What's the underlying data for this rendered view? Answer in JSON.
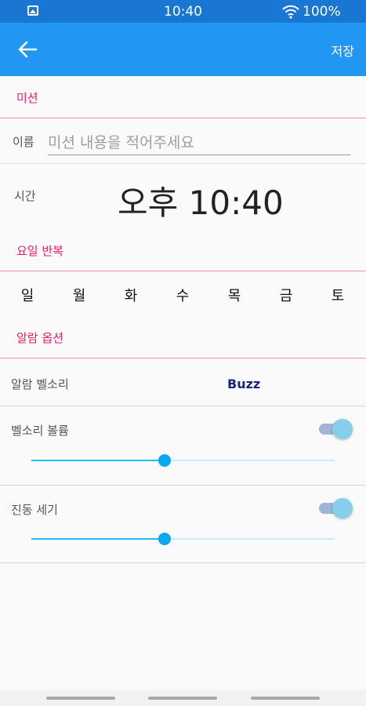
{
  "status_bar": {
    "time": "10:40",
    "battery": "100%",
    "icons": [
      "gallery-icon",
      "wifi-icon"
    ]
  },
  "app_bar": {
    "back_icon": "arrow-left-icon",
    "save_label": "저장"
  },
  "mission": {
    "header": "미션",
    "name_label": "이름",
    "name_value": "",
    "name_placeholder": "미션 내용을 적어주세요",
    "time_label": "시간",
    "time_value": "오후 10:40"
  },
  "repeat": {
    "header": "요일 반복",
    "days": [
      "일",
      "월",
      "화",
      "수",
      "목",
      "금",
      "토"
    ]
  },
  "alarm_options": {
    "header": "알람 옵션",
    "ringtone_label": "알람 벨소리",
    "ringtone_value": "Buzz",
    "volume_label": "벨소리 볼륨",
    "volume_enabled": true,
    "volume_level": 0.44,
    "vibration_label": "진동 세기",
    "vibration_enabled": true,
    "vibration_level": 0.44
  },
  "colors": {
    "status_bar": "#1976d2",
    "app_bar": "#2196f3",
    "section_header": "#e91e63",
    "slider": "#03a9f4",
    "ringtone_value": "#1a237e"
  }
}
